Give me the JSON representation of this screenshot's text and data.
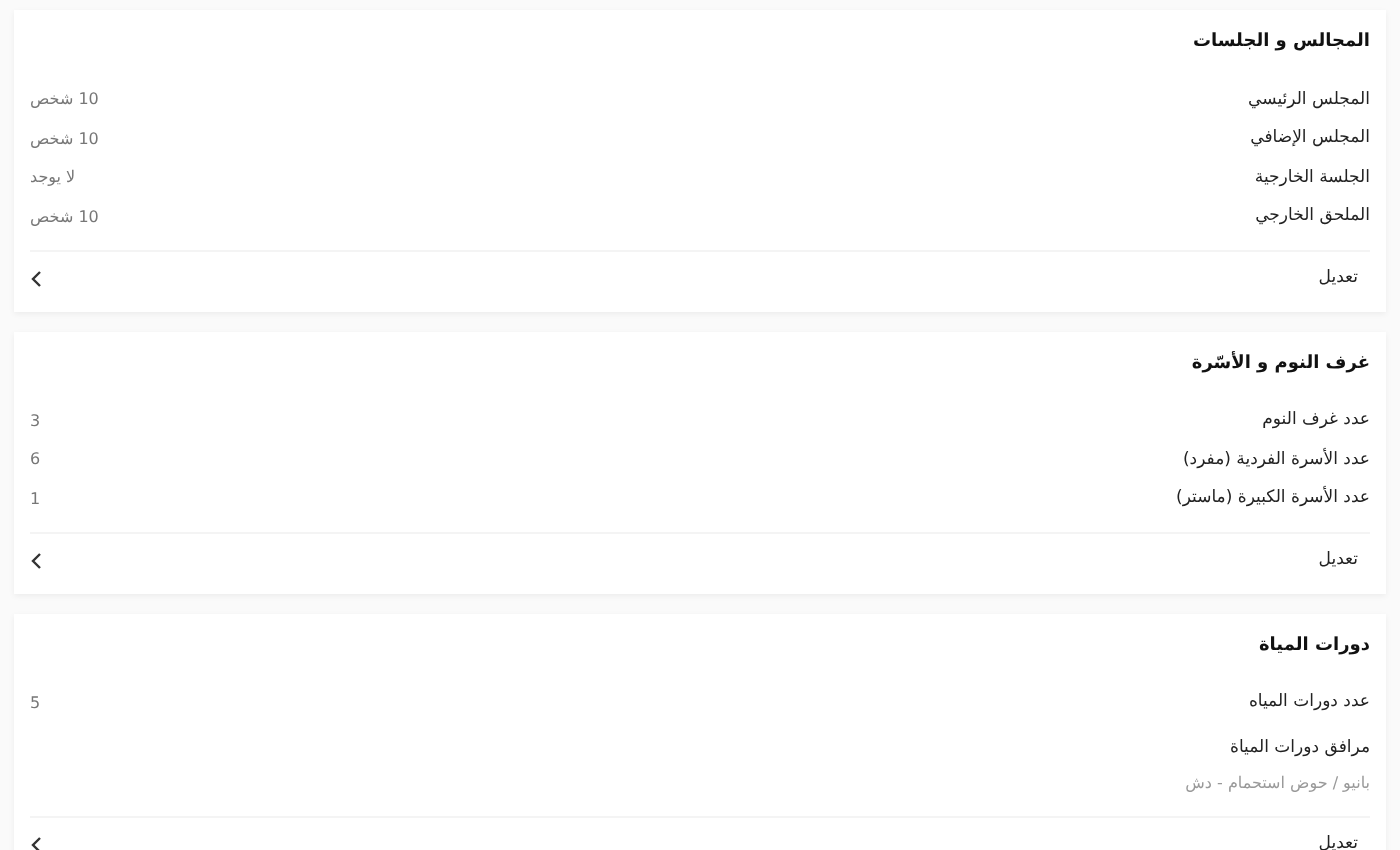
{
  "sections": [
    {
      "title": "المجالس و الجلسات",
      "rows": [
        {
          "kind": "pair",
          "label": "المجلس الرئيسي",
          "value": "10 شخص"
        },
        {
          "kind": "pair",
          "label": "المجلس الإضافي",
          "value": "10 شخص"
        },
        {
          "kind": "pair",
          "label": "الجلسة الخارجية",
          "value": "لا يوجد"
        },
        {
          "kind": "pair",
          "label": "الملحق الخارجي",
          "value": "10 شخص"
        }
      ],
      "edit": "تعديل"
    },
    {
      "title": "غرف النوم و الأسّرة",
      "rows": [
        {
          "kind": "pair",
          "label": "عدد غرف النوم",
          "value": "3"
        },
        {
          "kind": "pair",
          "label": "عدد الأسرة الفردية (مفرد)",
          "value": "6"
        },
        {
          "kind": "pair",
          "label": "عدد الأسرة الكبيرة (ماستر)",
          "value": "1"
        }
      ],
      "edit": "تعديل"
    },
    {
      "title": "دورات المياة",
      "rows": [
        {
          "kind": "pair",
          "label": "عدد دورات المياه",
          "value": "5"
        },
        {
          "kind": "stacked",
          "label": "مرافق دورات المياة",
          "value": "بانيو / حوض استحمام - دش"
        }
      ],
      "edit": "تعديل"
    }
  ]
}
